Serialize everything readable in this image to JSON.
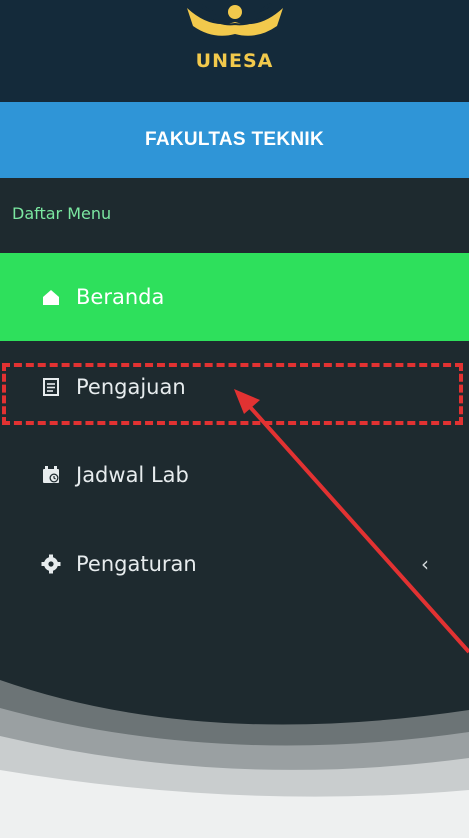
{
  "brand": {
    "logo_text": "UNESA",
    "faculty": "FAKULTAS TEKNIK"
  },
  "menu": {
    "header": "Daftar Menu",
    "items": [
      {
        "label": "Beranda",
        "icon": "home-icon",
        "active": true
      },
      {
        "label": "Pengajuan",
        "icon": "document-icon",
        "active": false
      },
      {
        "label": "Jadwal Lab",
        "icon": "calendar-icon",
        "active": false
      },
      {
        "label": "Pengaturan",
        "icon": "gear-icon",
        "active": false,
        "has_submenu": true
      }
    ],
    "submenu_chevron": "‹"
  },
  "colors": {
    "sidebar_bg": "#1e2a2f",
    "header_bg": "#142a3a",
    "band_bg": "#2f95d7",
    "active_bg": "#2ee05c",
    "annotation": "#e23232",
    "menu_header": "#7be8a1"
  }
}
